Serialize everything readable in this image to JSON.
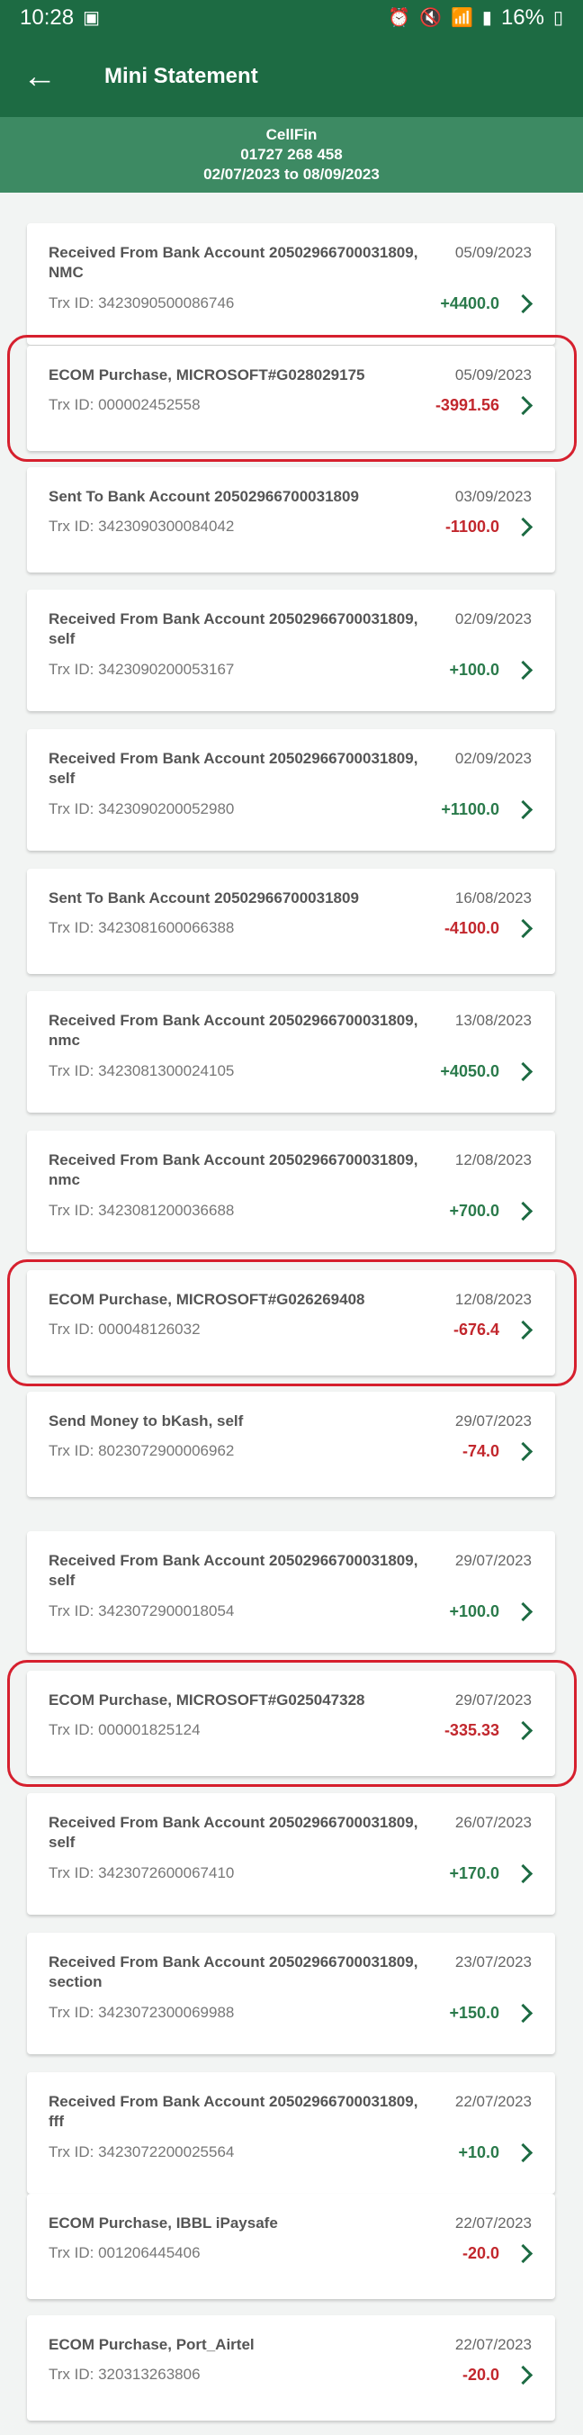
{
  "status_bar": {
    "time": "10:28",
    "battery": "16%"
  },
  "app_bar": {
    "title": "Mini Statement"
  },
  "summary": {
    "service": "CellFin",
    "account": "01727  268  458",
    "period": "02/07/2023 to 08/09/2023"
  },
  "colors": {
    "primary": "#1d6b43",
    "credit": "#2a7a4b",
    "debit": "#c2272d",
    "highlight": "#d6202e"
  },
  "transactions": [
    {
      "title": "Received From Bank Account 20502966700031809, NMC",
      "trx": "Trx ID: 3423090500086746",
      "date": "05/09/2023",
      "amount": "+4400.0",
      "type": "credit",
      "highlighted": false
    },
    {
      "title": "ECOM Purchase, MICROSOFT#G028029175",
      "trx": "Trx ID: 000002452558",
      "date": "05/09/2023",
      "amount": "-3991.56",
      "type": "debit",
      "highlighted": true
    },
    {
      "title": "Sent To Bank Account 20502966700031809",
      "trx": "Trx ID: 3423090300084042",
      "date": "03/09/2023",
      "amount": "-1100.0",
      "type": "debit",
      "highlighted": false
    },
    {
      "title": "Received From Bank Account 20502966700031809, self",
      "trx": "Trx ID: 3423090200053167",
      "date": "02/09/2023",
      "amount": "+100.0",
      "type": "credit",
      "highlighted": false
    },
    {
      "title": "Received From Bank Account 20502966700031809, self",
      "trx": "Trx ID: 3423090200052980",
      "date": "02/09/2023",
      "amount": "+1100.0",
      "type": "credit",
      "highlighted": false
    },
    {
      "title": "Sent To Bank Account 20502966700031809",
      "trx": "Trx ID: 3423081600066388",
      "date": "16/08/2023",
      "amount": "-4100.0",
      "type": "debit",
      "highlighted": false
    },
    {
      "title": "Received From Bank Account 20502966700031809, nmc",
      "trx": "Trx ID: 3423081300024105",
      "date": "13/08/2023",
      "amount": "+4050.0",
      "type": "credit",
      "highlighted": false
    },
    {
      "title": "Received From Bank Account 20502966700031809, nmc",
      "trx": "Trx ID: 3423081200036688",
      "date": "12/08/2023",
      "amount": "+700.0",
      "type": "credit",
      "highlighted": false
    },
    {
      "title": "ECOM Purchase, MICROSOFT#G026269408",
      "trx": "Trx ID: 000048126032",
      "date": "12/08/2023",
      "amount": "-676.4",
      "type": "debit",
      "highlighted": true
    },
    {
      "title": "Send Money to bKash, self",
      "trx": "Trx ID: 8023072900006962",
      "date": "29/07/2023",
      "amount": "-74.0",
      "type": "debit",
      "highlighted": false
    },
    {
      "title": "Received From Bank Account 20502966700031809, self",
      "trx": "Trx ID: 3423072900018054",
      "date": "29/07/2023",
      "amount": "+100.0",
      "type": "credit",
      "highlighted": false
    },
    {
      "title": "ECOM Purchase, MICROSOFT#G025047328",
      "trx": "Trx ID: 000001825124",
      "date": "29/07/2023",
      "amount": "-335.33",
      "type": "debit",
      "highlighted": true
    },
    {
      "title": "Received From Bank Account 20502966700031809, self",
      "trx": "Trx ID: 3423072600067410",
      "date": "26/07/2023",
      "amount": "+170.0",
      "type": "credit",
      "highlighted": false
    },
    {
      "title": "Received From Bank Account 20502966700031809, section",
      "trx": "Trx ID: 3423072300069988",
      "date": "23/07/2023",
      "amount": "+150.0",
      "type": "credit",
      "highlighted": false
    },
    {
      "title": "Received From Bank Account 20502966700031809, fff",
      "trx": "Trx ID: 3423072200025564",
      "date": "22/07/2023",
      "amount": "+10.0",
      "type": "credit",
      "highlighted": false
    },
    {
      "title": "ECOM Purchase, IBBL iPaysafe",
      "trx": "Trx ID: 001206445406",
      "date": "22/07/2023",
      "amount": "-20.0",
      "type": "debit",
      "highlighted": false
    },
    {
      "title": "ECOM Purchase, Port_Airtel",
      "trx": "Trx ID: 320313263806",
      "date": "22/07/2023",
      "amount": "-20.0",
      "type": "debit",
      "highlighted": false
    }
  ]
}
